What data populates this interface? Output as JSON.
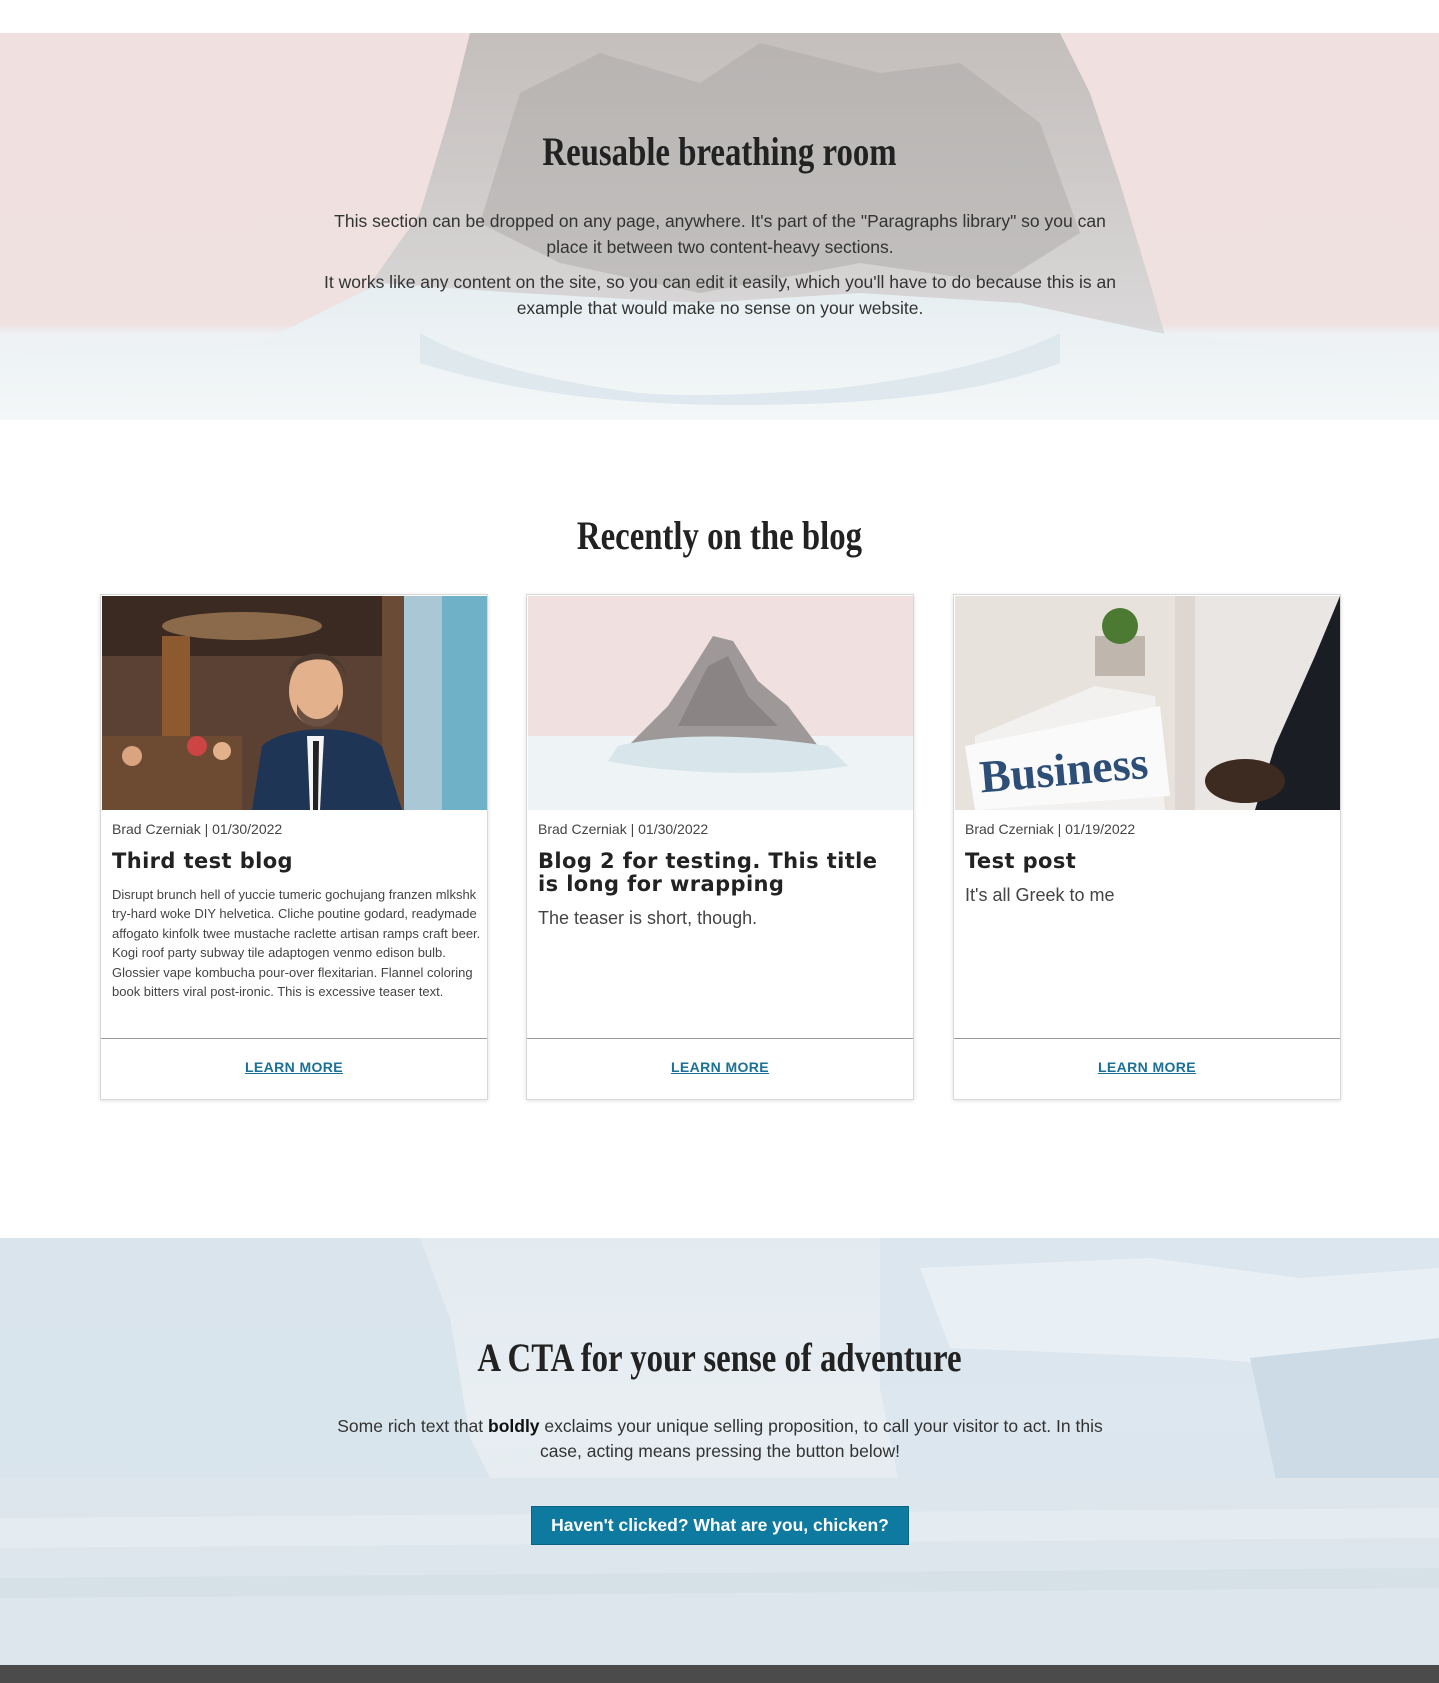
{
  "hero": {
    "title": "Reusable breathing room",
    "paragraph_1": "This section can be dropped on any page, anywhere. It's part of the \"Paragraphs library\" so you can place it between two content-heavy sections.",
    "paragraph_2": "It works like any content on the site, so you can edit it easily, which you'll have to do because this is an example that would make no sense on your website."
  },
  "blog": {
    "title": "Recently on the blog",
    "cards": [
      {
        "image": "man-in-suit-photo",
        "meta": "Brad Czerniak | 01/30/2022",
        "title": "Third test blog",
        "teaser": "Disrupt brunch hell of yuccie tumeric gochujang franzen mlkshk try-hard woke DIY helvetica. Cliche poutine godard, readymade affogato kinfolk twee mustache raclette artisan ramps craft beer. Kogi roof party subway tile adaptogen venmo edison bulb. Glossier vape kombucha pour-over flexitarian. Flannel coloring book bitters viral post-ironic. This is excessive teaser text.",
        "link": "LEARN MORE"
      },
      {
        "image": "ice-mountain-photo",
        "meta": "Brad Czerniak | 01/30/2022",
        "title": "Blog 2 for testing. This title is long for wrapping",
        "teaser": "The teaser is short, though.",
        "link": "LEARN MORE"
      },
      {
        "image": "business-newspaper-photo",
        "meta": "Brad Czerniak | 01/19/2022",
        "title": "Test post",
        "teaser": "It's all Greek to me",
        "link": "LEARN MORE"
      }
    ]
  },
  "cta": {
    "title": "A CTA for your sense of adventure",
    "text_before": "Some rich text that ",
    "text_bold": "boldly",
    "text_after": " exclaims your unique selling proposition, to call your visitor to act. In this case, acting means pressing the button below!",
    "button_label": "Haven't clicked? What are you, chicken?"
  },
  "colors": {
    "accent": "#0e7aa0",
    "link": "#1a7097",
    "footer": "#4b4b4b"
  }
}
